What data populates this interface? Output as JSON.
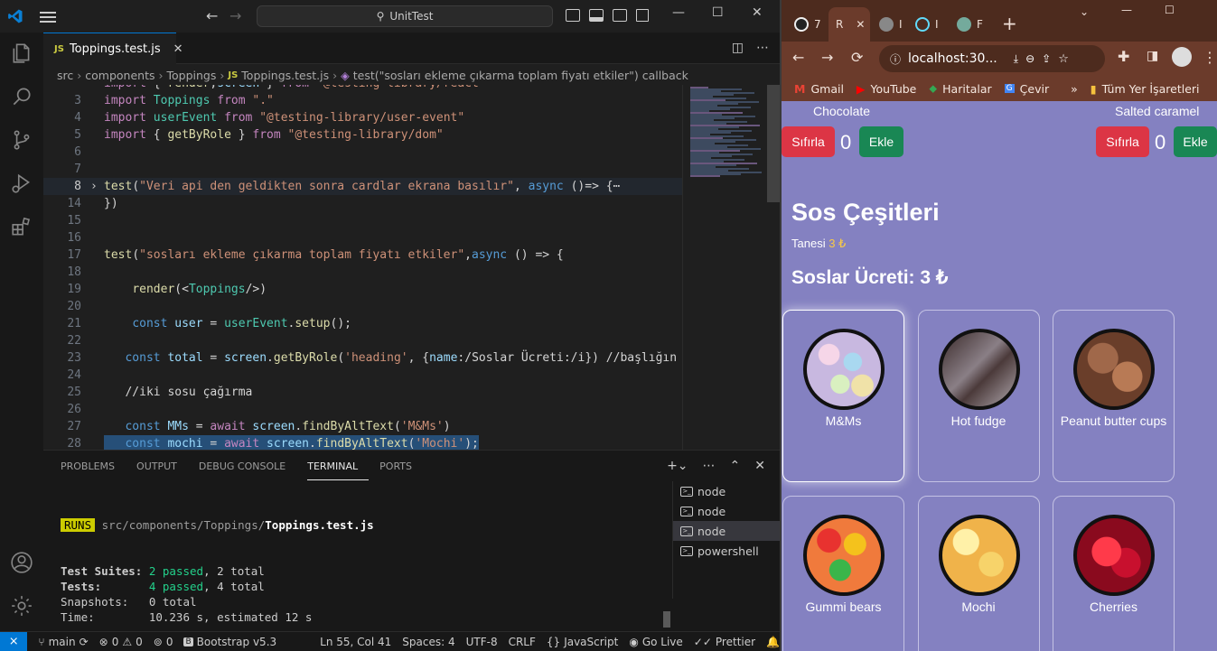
{
  "vscode": {
    "command_center": "UnitTest",
    "tab": {
      "lang": "JS",
      "filename": "Toppings.test.js"
    },
    "breadcrumb": [
      "src",
      "components",
      "Toppings",
      "Toppings.test.js",
      "test(\"sosları ekleme çıkarma toplam fiyatı etkiler\") callback"
    ],
    "code_lines": [
      {
        "n": "",
        "text": "import { render,screen } from \"@testing-library/react\""
      },
      {
        "n": "3",
        "text": "import Toppings from \".\""
      },
      {
        "n": "4",
        "text": "import userEvent from \"@testing-library/user-event\""
      },
      {
        "n": "5",
        "text": "import { getByRole } from \"@testing-library/dom\""
      },
      {
        "n": "6",
        "text": ""
      },
      {
        "n": "7",
        "text": ""
      },
      {
        "n": "8",
        "text": "test(\"Veri api den geldikten sonra cardlar ekrana basılır\", async ()=> {⋯"
      },
      {
        "n": "14",
        "text": "})"
      },
      {
        "n": "15",
        "text": ""
      },
      {
        "n": "16",
        "text": ""
      },
      {
        "n": "17",
        "text": "test(\"sosları ekleme çıkarma toplam fiyatı etkiler\",async () => {"
      },
      {
        "n": "18",
        "text": ""
      },
      {
        "n": "19",
        "text": "    render(<Toppings/>)"
      },
      {
        "n": "20",
        "text": ""
      },
      {
        "n": "21",
        "text": "    const user = userEvent.setup();"
      },
      {
        "n": "22",
        "text": ""
      },
      {
        "n": "23",
        "text": "   const total = screen.getByRole('heading', {name:/Soslar Ücreti:/i}) //başlığın de"
      },
      {
        "n": "24",
        "text": ""
      },
      {
        "n": "25",
        "text": "   //iki sosu çağırma"
      },
      {
        "n": "26",
        "text": ""
      },
      {
        "n": "27",
        "text": "   const MMs = await screen.findByAltText('M&Ms')"
      },
      {
        "n": "28",
        "text": "   const mochi = await screen.findByAltText('Mochi');"
      }
    ],
    "panel_tabs": [
      "PROBLEMS",
      "OUTPUT",
      "DEBUG CONSOLE",
      "TERMINAL",
      "PORTS"
    ],
    "terminal": {
      "runs_badge": "RUNS",
      "path_prefix": "src/components/Toppings/",
      "path_file": "Toppings.test.js",
      "suites_label": "Test Suites: ",
      "suites_passed": "2 passed",
      "suites_total": ", 2 total",
      "tests_label": "Tests:       ",
      "tests_passed": "4 passed",
      "tests_total": ", 4 total",
      "snapshots": "Snapshots:   0 total",
      "time": "Time:        10.236 s, estimated 12 s"
    },
    "terminal_list": [
      "node",
      "node",
      "node",
      "powershell"
    ],
    "status": {
      "branch": "main",
      "errors": "0",
      "warnings": "0",
      "ports": "0",
      "bootstrap": "Bootstrap v5.3",
      "position": "Ln 55, Col 41",
      "spaces": "Spaces: 4",
      "encoding": "UTF-8",
      "eol": "CRLF",
      "language": "JavaScript",
      "golive": "Go Live",
      "prettier": "Prettier"
    }
  },
  "browser": {
    "tabs": [
      "7",
      "R",
      "I",
      "I",
      "F"
    ],
    "url": "localhost:30...",
    "bookmarks": [
      "Gmail",
      "YouTube",
      "Haritalar",
      "Çevir"
    ],
    "bookmarks_more": "»",
    "all_bookmarks": "Tüm Yer İşaretleri"
  },
  "app": {
    "flavor_left": "Chocolate",
    "flavor_right": "Salted caramel",
    "reset_label": "Sıfırla",
    "add_label": "Ekle",
    "count_left": "0",
    "count_right": "0",
    "heading": "Sos Çeşitleri",
    "unit_label": "Tanesi",
    "unit_price": "3 ₺",
    "total_heading": "Soslar Ücreti: 3 ₺",
    "toppings": [
      {
        "name": "M&Ms",
        "selected": true
      },
      {
        "name": "Hot fudge",
        "selected": false
      },
      {
        "name": "Peanut butter cups",
        "selected": false
      },
      {
        "name": "Gummi bears",
        "selected": false
      },
      {
        "name": "Mochi",
        "selected": false
      },
      {
        "name": "Cherries",
        "selected": false
      }
    ]
  },
  "colors": {
    "vscode_bg": "#1f1f1f",
    "accent_blue": "#0078d4",
    "page_bg": "#8481c1",
    "btn_red": "#dc3545",
    "btn_green": "#198754",
    "price_yellow": "#f7c948"
  }
}
